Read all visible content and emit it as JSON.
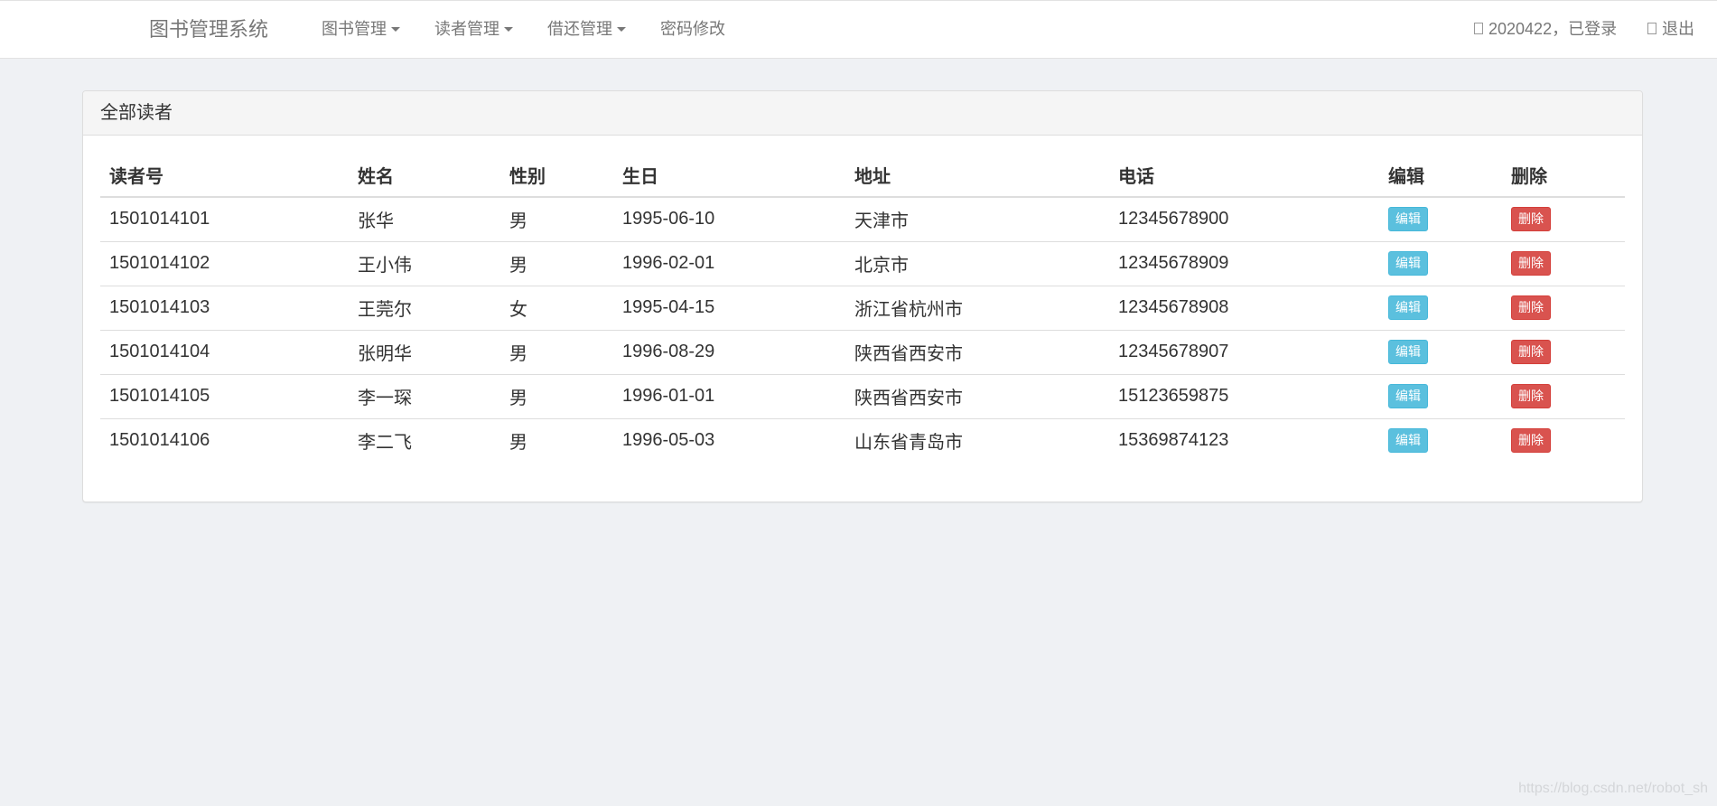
{
  "navbar": {
    "brand": "图书管理系统",
    "menus": [
      {
        "label": "图书管理",
        "dropdown": true
      },
      {
        "label": "读者管理",
        "dropdown": true
      },
      {
        "label": "借还管理",
        "dropdown": true
      },
      {
        "label": "密码修改",
        "dropdown": false
      }
    ],
    "user_status": "2020422，已登录",
    "logout": "退出"
  },
  "panel": {
    "title": "全部读者",
    "columns": [
      "读者号",
      "姓名",
      "性别",
      "生日",
      "地址",
      "电话",
      "编辑",
      "删除"
    ],
    "rows": [
      {
        "id": "1501014101",
        "name": "张华",
        "sex": "男",
        "birth": "1995-06-10",
        "address": "天津市",
        "phone": "12345678900"
      },
      {
        "id": "1501014102",
        "name": "王小伟",
        "sex": "男",
        "birth": "1996-02-01",
        "address": "北京市",
        "phone": "12345678909"
      },
      {
        "id": "1501014103",
        "name": "王莞尔",
        "sex": "女",
        "birth": "1995-04-15",
        "address": "浙江省杭州市",
        "phone": "12345678908"
      },
      {
        "id": "1501014104",
        "name": "张明华",
        "sex": "男",
        "birth": "1996-08-29",
        "address": "陕西省西安市",
        "phone": "12345678907"
      },
      {
        "id": "1501014105",
        "name": "李一琛",
        "sex": "男",
        "birth": "1996-01-01",
        "address": "陕西省西安市",
        "phone": "15123659875"
      },
      {
        "id": "1501014106",
        "name": "李二飞",
        "sex": "男",
        "birth": "1996-05-03",
        "address": "山东省青岛市",
        "phone": "15369874123"
      }
    ],
    "edit_label": "编辑",
    "delete_label": "删除"
  },
  "watermark": "https://blog.csdn.net/robot_sh",
  "colors": {
    "info": "#5bc0de",
    "danger": "#d9534f",
    "background": "#eff1f4"
  }
}
